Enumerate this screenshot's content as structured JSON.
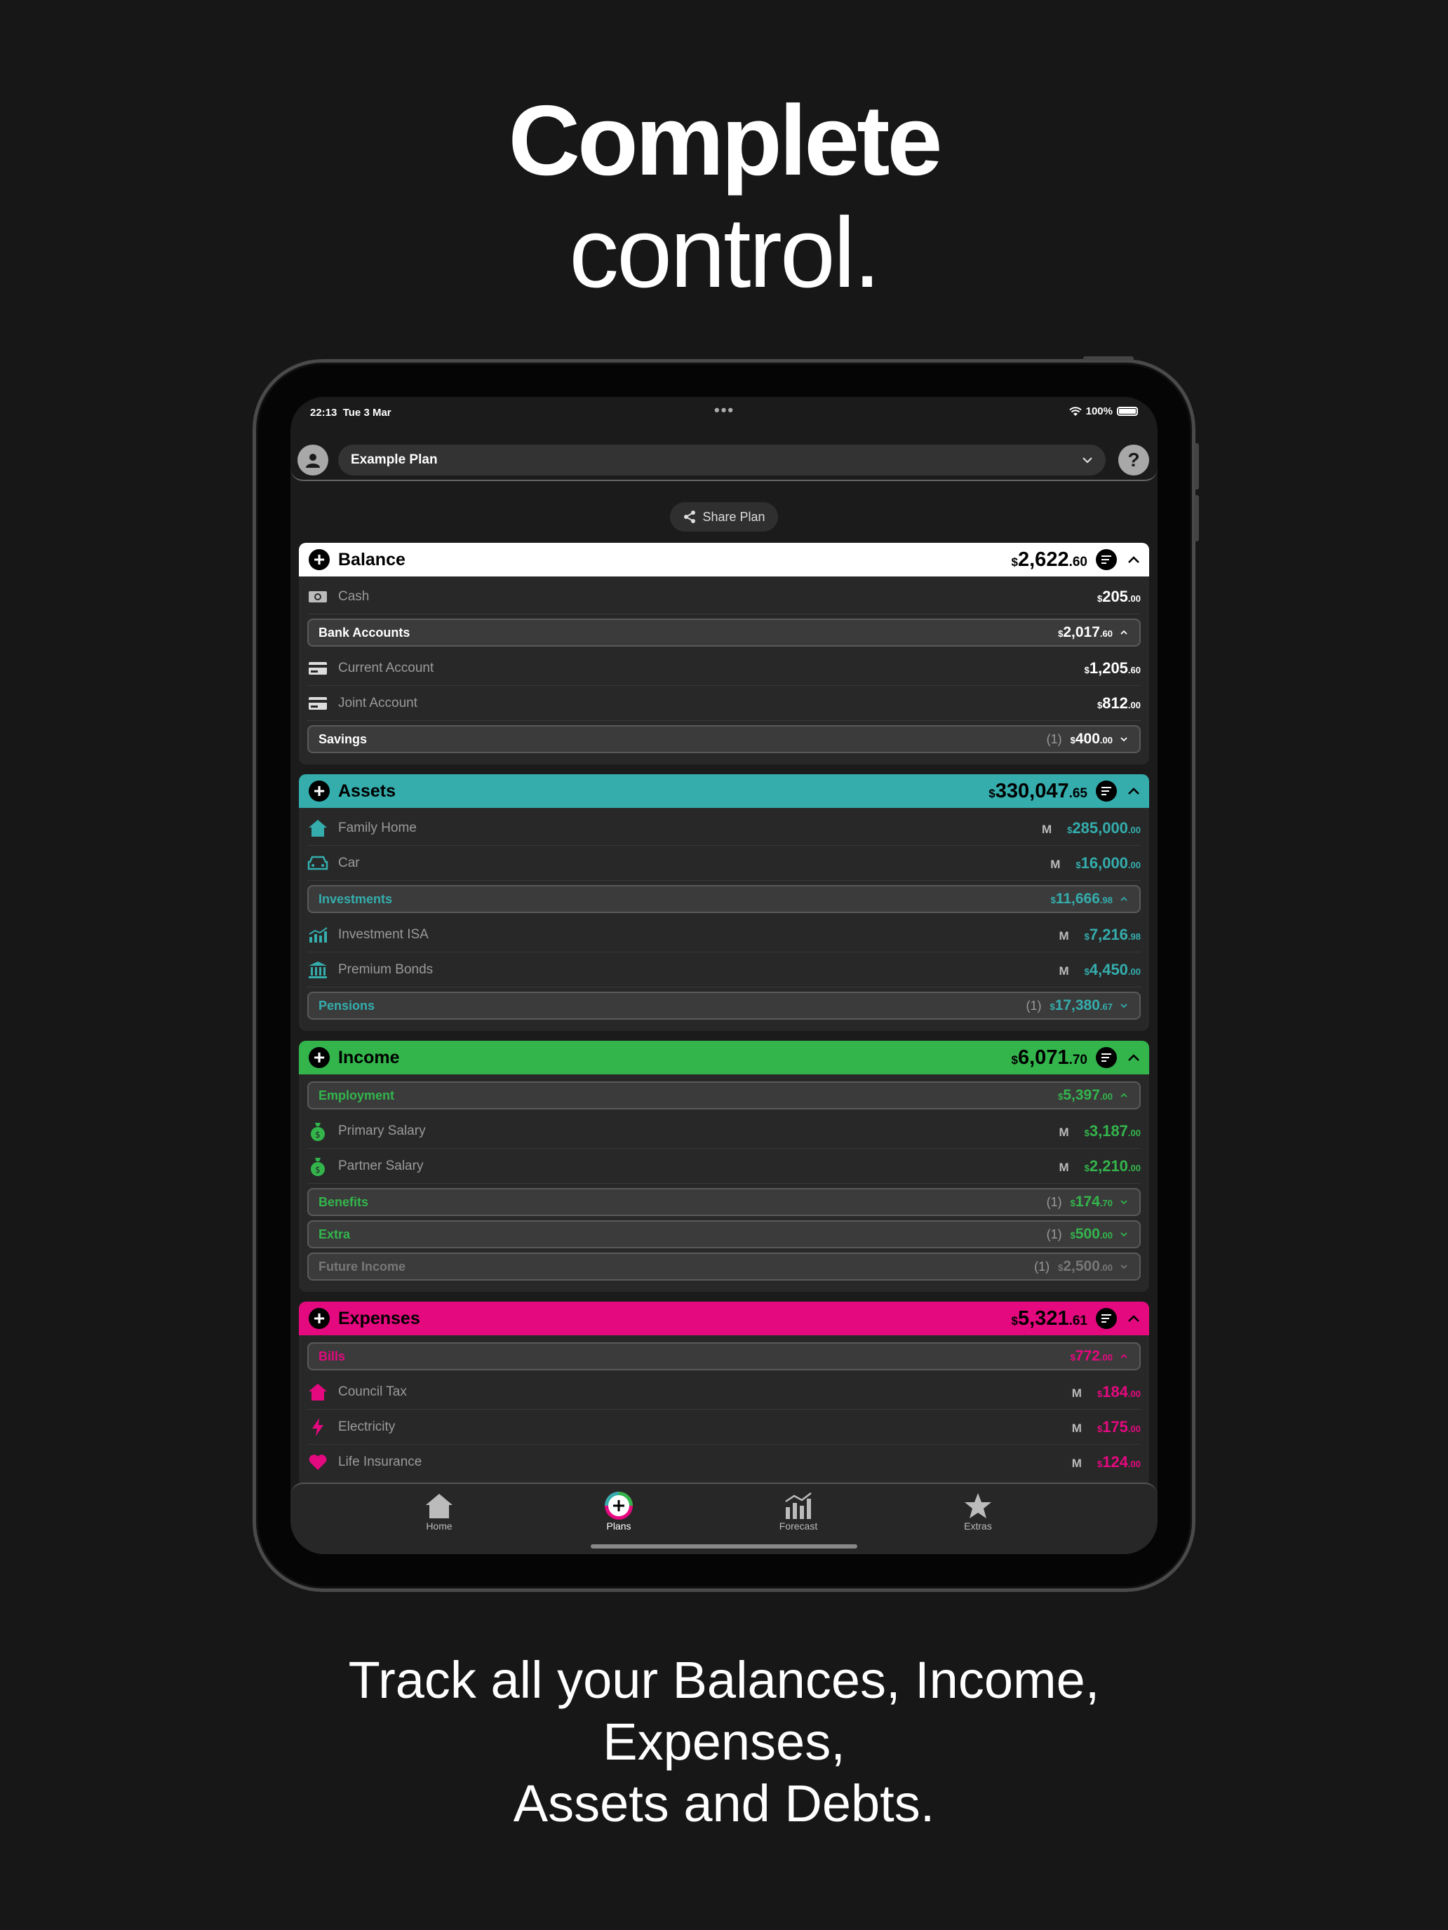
{
  "headline": {
    "line1": "Complete",
    "line2": "control."
  },
  "tagline": {
    "line1": "Track all your Balances, Income,",
    "line2": "Expenses,",
    "line3": "Assets and Debts."
  },
  "status_bar": {
    "time": "22:13",
    "date": "Tue 3 Mar",
    "battery": "100%"
  },
  "plan_selector": {
    "name": "Example Plan"
  },
  "help_button": {
    "label": "?"
  },
  "share_button": {
    "label": "Share Plan"
  },
  "sections": {
    "balance": {
      "title": "Balance",
      "color": "#ffffff",
      "accent": "#ffffff",
      "total": {
        "cur": "$",
        "int": "2,622",
        "dec": ".60"
      },
      "cash": {
        "label": "Cash",
        "cur": "$",
        "int": "205",
        "dec": ".00"
      },
      "bank_accounts": {
        "label": "Bank Accounts",
        "cur": "$",
        "int": "2,017",
        "dec": ".60"
      },
      "current_account": {
        "label": "Current Account",
        "cur": "$",
        "int": "1,205",
        "dec": ".60"
      },
      "joint_account": {
        "label": "Joint Account",
        "cur": "$",
        "int": "812",
        "dec": ".00"
      },
      "savings": {
        "label": "Savings",
        "count": "(1)",
        "cur": "$",
        "int": "400",
        "dec": ".00"
      }
    },
    "assets": {
      "title": "Assets",
      "color": "#35adad",
      "total": {
        "cur": "$",
        "int": "330,047",
        "dec": ".65"
      },
      "family_home": {
        "label": "Family Home",
        "freq": "M",
        "cur": "$",
        "int": "285,000",
        "dec": ".00"
      },
      "car": {
        "label": "Car",
        "freq": "M",
        "cur": "$",
        "int": "16,000",
        "dec": ".00"
      },
      "investments": {
        "label": "Investments",
        "cur": "$",
        "int": "11,666",
        "dec": ".98"
      },
      "investment_isa": {
        "label": "Investment ISA",
        "freq": "M",
        "cur": "$",
        "int": "7,216",
        "dec": ".98"
      },
      "premium_bonds": {
        "label": "Premium Bonds",
        "freq": "M",
        "cur": "$",
        "int": "4,450",
        "dec": ".00"
      },
      "pensions": {
        "label": "Pensions",
        "count": "(1)",
        "cur": "$",
        "int": "17,380",
        "dec": ".67"
      }
    },
    "income": {
      "title": "Income",
      "color": "#33b54c",
      "total": {
        "cur": "$",
        "int": "6,071",
        "dec": ".70"
      },
      "employment": {
        "label": "Employment",
        "cur": "$",
        "int": "5,397",
        "dec": ".00"
      },
      "primary_salary": {
        "label": "Primary Salary",
        "freq": "M",
        "cur": "$",
        "int": "3,187",
        "dec": ".00"
      },
      "partner_salary": {
        "label": "Partner Salary",
        "freq": "M",
        "cur": "$",
        "int": "2,210",
        "dec": ".00"
      },
      "benefits": {
        "label": "Benefits",
        "count": "(1)",
        "cur": "$",
        "int": "174",
        "dec": ".70"
      },
      "extra": {
        "label": "Extra",
        "count": "(1)",
        "cur": "$",
        "int": "500",
        "dec": ".00"
      },
      "future_income": {
        "label": "Future Income",
        "count": "(1)",
        "cur": "$",
        "int": "2,500",
        "dec": ".00"
      }
    },
    "expenses": {
      "title": "Expenses",
      "color": "#e5097f",
      "total": {
        "cur": "$",
        "int": "5,321",
        "dec": ".61"
      },
      "bills": {
        "label": "Bills",
        "cur": "$",
        "int": "772",
        "dec": ".00"
      },
      "council_tax": {
        "label": "Council Tax",
        "freq": "M",
        "cur": "$",
        "int": "184",
        "dec": ".00"
      },
      "electricity": {
        "label": "Electricity",
        "freq": "M",
        "cur": "$",
        "int": "175",
        "dec": ".00"
      },
      "life_insurance": {
        "label": "Life Insurance",
        "freq": "M",
        "cur": "$",
        "int": "124",
        "dec": ".00"
      }
    }
  },
  "tab_bar": {
    "home": "Home",
    "plans": "Plans",
    "forecast": "Forecast",
    "extras": "Extras"
  }
}
